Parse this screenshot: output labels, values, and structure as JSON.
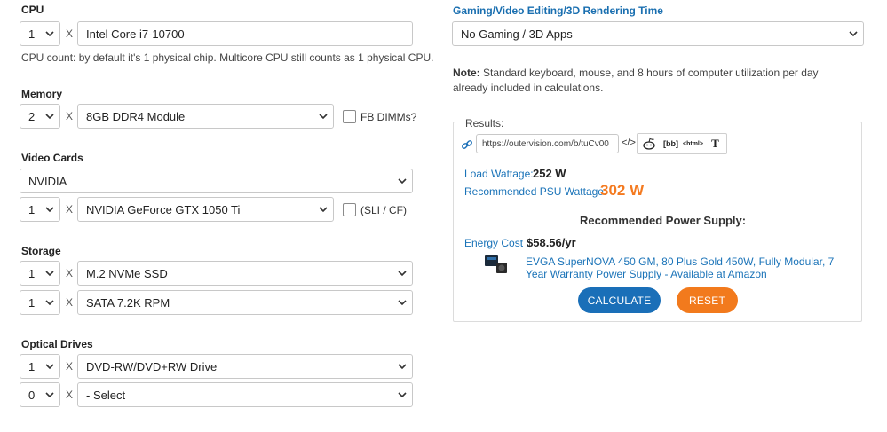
{
  "cpu": {
    "label": "CPU",
    "count": "1",
    "times": "X",
    "model": "Intel Core i7-10700",
    "hint": "CPU count: by default it's 1 physical chip. Multicore CPU still counts as 1 physical CPU."
  },
  "memory": {
    "label": "Memory",
    "count": "2",
    "times": "X",
    "module": "8GB DDR4 Module",
    "fb_label": "FB DIMMs?"
  },
  "video": {
    "label": "Video Cards",
    "brand": "NVIDIA",
    "count": "1",
    "times": "X",
    "model": "NVIDIA GeForce GTX 1050 Ti",
    "sli_label": "(SLI / CF)"
  },
  "storage": {
    "label": "Storage",
    "items": [
      {
        "count": "1",
        "times": "X",
        "type": "M.2 NVMe SSD"
      },
      {
        "count": "1",
        "times": "X",
        "type": "SATA 7.2K RPM"
      }
    ]
  },
  "optical": {
    "label": "Optical Drives",
    "items": [
      {
        "count": "1",
        "times": "X",
        "type": "DVD-RW/DVD+RW Drive"
      },
      {
        "count": "0",
        "times": "X",
        "type": "- Select"
      }
    ]
  },
  "gaming": {
    "label": "Gaming/Video Editing/3D Rendering Time",
    "value": "No Gaming / 3D Apps"
  },
  "note": {
    "bold": "Note:",
    "text": " Standard keyboard, mouse, and 8 hours of computer utilization per day already included in calculations."
  },
  "results": {
    "label": "Results:",
    "url": "https://outervision.com/b/tuCv00",
    "share_buttons": [
      {
        "icon": "code-icon",
        "text": "</>"
      },
      {
        "icon": "reddit-icon",
        "text": ""
      },
      {
        "icon": "bbcode-icon",
        "text": "[bb]"
      },
      {
        "icon": "html-icon",
        "text": "<html>"
      },
      {
        "icon": "text-icon",
        "text": "T"
      }
    ],
    "load_label": "Load Wattage:",
    "load_value": "252 W",
    "psu_label": "Recommended PSU Wattage:",
    "psu_value": "302 W",
    "rec_title": "Recommended Power Supply:",
    "energy_label": "Energy Cost :",
    "energy_value": "$58.56/yr",
    "product_link": "EVGA SuperNOVA 450 GM, 80 Plus Gold 450W, Fully Modular, 7 Year Warranty Power Supply - Available at Amazon",
    "calculate": "CALCULATE",
    "reset": "RESET"
  },
  "colors": {
    "accent_blue": "#1a6fb8",
    "accent_orange": "#f27a1d",
    "psu_orange": "#f47a20"
  }
}
